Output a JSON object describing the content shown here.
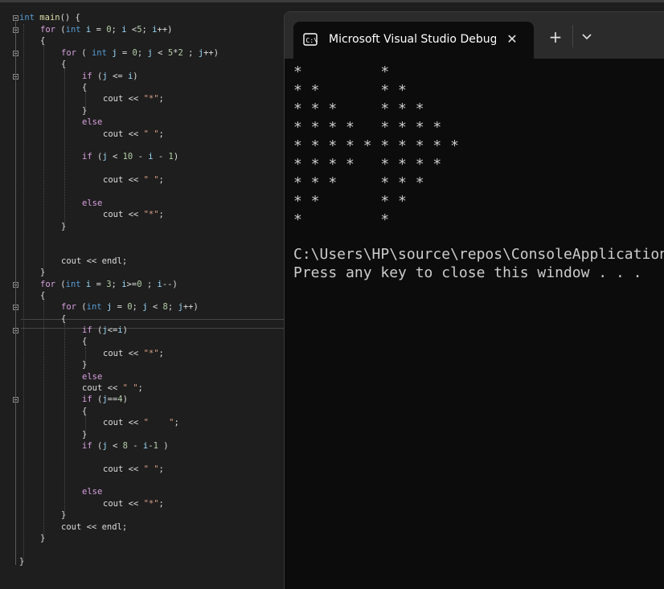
{
  "editor": {
    "lines": [
      {
        "key": "l1",
        "text": "int main() {"
      },
      {
        "key": "l2",
        "text": "for (int i = 0; i <5; i++)"
      },
      {
        "key": "l3",
        "text": "{"
      },
      {
        "key": "l4",
        "text": "for ( int j = 0; j < 5*2 ; j++)"
      },
      {
        "key": "l5",
        "text": "{"
      },
      {
        "key": "l6",
        "text": "if (j <= i)"
      },
      {
        "key": "l7",
        "text": "{"
      },
      {
        "key": "l8",
        "text": "cout << \"*\";"
      },
      {
        "key": "l9",
        "text": "}"
      },
      {
        "key": "l10",
        "text": "else"
      },
      {
        "key": "l11",
        "text": "cout << \" \";"
      },
      {
        "key": "l12",
        "text": "if (j < 10 - i - 1)"
      },
      {
        "key": "l13",
        "text": "cout << \" \";"
      },
      {
        "key": "l14",
        "text": "else"
      },
      {
        "key": "l15",
        "text": "cout << \"*\";"
      },
      {
        "key": "l16",
        "text": "}"
      },
      {
        "key": "l17",
        "text": "cout << endl;"
      },
      {
        "key": "l18",
        "text": "}"
      },
      {
        "key": "l19",
        "text": "for (int i = 3; i>=0 ; i--)"
      },
      {
        "key": "l20",
        "text": "{"
      },
      {
        "key": "l21",
        "text": "for (int j = 0; j < 8; j++)"
      },
      {
        "key": "l22",
        "text": "{"
      },
      {
        "key": "l23",
        "text": "if (j<=i)"
      },
      {
        "key": "l24",
        "text": "{"
      },
      {
        "key": "l25",
        "text": "cout << \"*\";"
      },
      {
        "key": "l26",
        "text": "}"
      },
      {
        "key": "l27",
        "text": "else"
      },
      {
        "key": "l28",
        "text": "cout << \" \";"
      },
      {
        "key": "l29",
        "text": "if (j==4)"
      },
      {
        "key": "l30",
        "text": "{"
      },
      {
        "key": "l31",
        "text": "cout << \"    \";"
      },
      {
        "key": "l32",
        "text": "}"
      },
      {
        "key": "l33",
        "text": "if (j < 8 - i-1 )"
      },
      {
        "key": "l34",
        "text": "cout << \" \";"
      },
      {
        "key": "l35",
        "text": "else"
      },
      {
        "key": "l36",
        "text": "cout << \"*\";"
      },
      {
        "key": "l37",
        "text": "}"
      },
      {
        "key": "l38",
        "text": "cout << endl;"
      },
      {
        "key": "l39",
        "text": "}"
      },
      {
        "key": "l40",
        "text": "}"
      }
    ]
  },
  "terminal": {
    "tab_title": "Microsoft Visual Studio Debug Console",
    "tab_icon": "console-app-icon",
    "close_glyph": "✕",
    "new_tab_glyph": "+",
    "dropdown_icon": "chevron-down-icon",
    "output": [
      "*         *",
      "* *       * *",
      "* * *     * * *",
      "* * * *   * * * *",
      "* * * * * * * * * *",
      "* * * *   * * * *",
      "* * *     * * *",
      "* *       * *",
      "*         *",
      "",
      "C:\\Users\\HP\\source\\repos\\ConsoleApplication",
      "Press any key to close this window . . ."
    ]
  }
}
